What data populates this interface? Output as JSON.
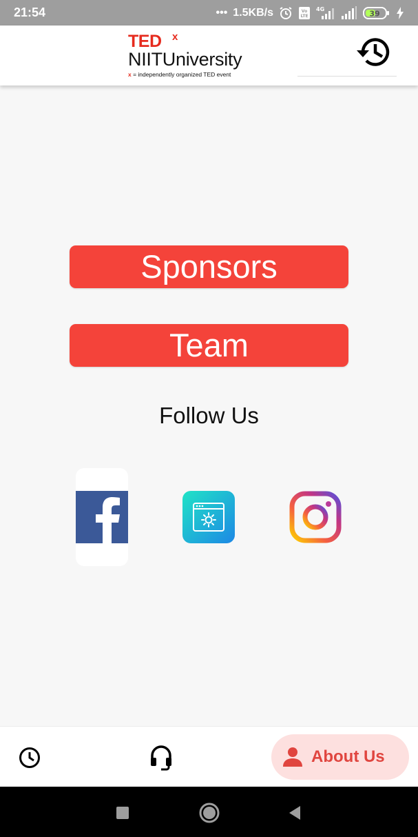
{
  "status_bar": {
    "time": "21:54",
    "network_speed": "1.5KB/s",
    "battery": "39",
    "network_type": "4G"
  },
  "app_bar": {
    "logo": {
      "ted": "TED",
      "x": "x",
      "university": "NIITUniversity",
      "tagline_x": "x",
      "tagline": " = independently organized TED event"
    },
    "history_icon": "history-icon"
  },
  "main": {
    "sponsors_label": "Sponsors",
    "team_label": "Team",
    "follow_title": "Follow Us",
    "social": [
      "facebook-icon",
      "website-icon",
      "instagram-icon"
    ]
  },
  "bottom_nav": {
    "items": [
      {
        "icon": "clock-icon",
        "label": ""
      },
      {
        "icon": "headset-icon",
        "label": ""
      },
      {
        "icon": "person-icon",
        "label": "About Us",
        "active": true
      }
    ]
  },
  "colors": {
    "accent": "#f4433a",
    "ted_red": "#e62b1e",
    "about_active_bg": "#fde0df",
    "about_active_fg": "#e0453f"
  }
}
